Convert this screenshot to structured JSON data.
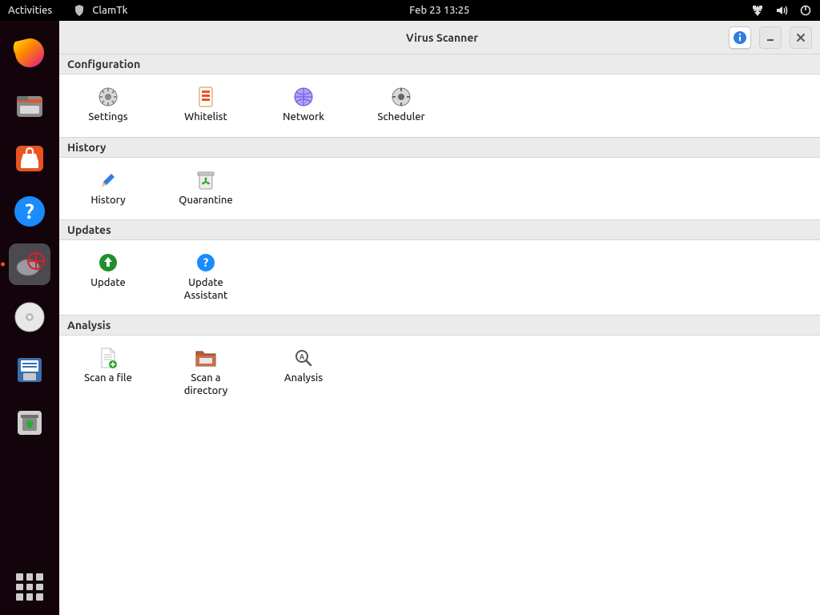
{
  "topbar": {
    "activities": "Activities",
    "app_name": "ClamTk",
    "clock": "Feb 23  13:25"
  },
  "window": {
    "title": "Virus Scanner"
  },
  "sections": {
    "configuration": {
      "heading": "Configuration",
      "items": {
        "settings": "Settings",
        "whitelist": "Whitelist",
        "network": "Network",
        "scheduler": "Scheduler"
      }
    },
    "history": {
      "heading": "History",
      "items": {
        "history": "History",
        "quarantine": "Quarantine"
      }
    },
    "updates": {
      "heading": "Updates",
      "items": {
        "update": "Update",
        "update_assistant": "Update\nAssistant"
      }
    },
    "analysis": {
      "heading": "Analysis",
      "items": {
        "scan_file": "Scan a file",
        "scan_dir": "Scan a\ndirectory",
        "analysis": "Analysis"
      }
    }
  }
}
